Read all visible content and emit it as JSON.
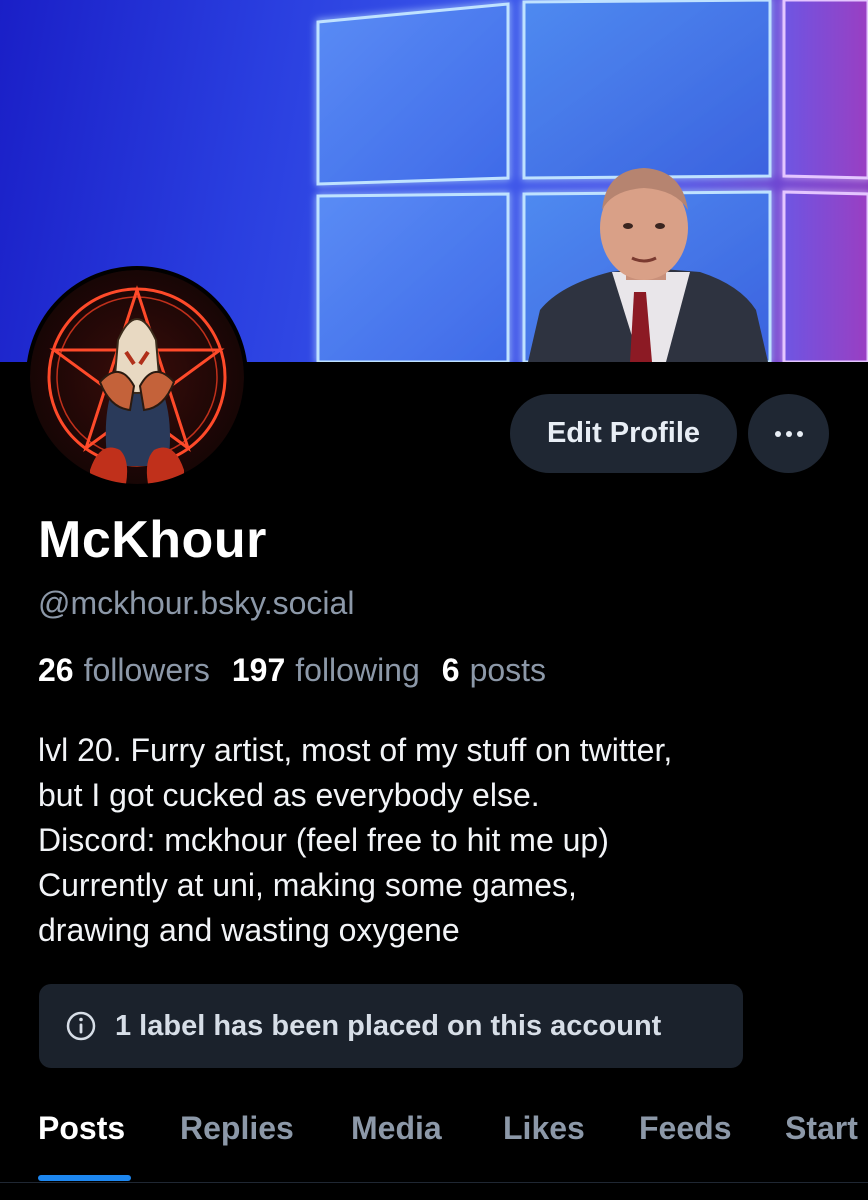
{
  "profile": {
    "display_name": "McKhour",
    "handle": "@mckhour.bsky.social",
    "stats": {
      "followers_count": "26",
      "followers_label": "followers",
      "following_count": "197",
      "following_label": "following",
      "posts_count": "6",
      "posts_label": "posts"
    },
    "bio_lines": [
      "lvl 20. Furry artist, most of my stuff on twitter,",
      "but I got cucked as everybody else.",
      "Discord: mckhour (feel free to hit me up)",
      "Currently at uni, making some games,",
      "drawing and wasting oxygene"
    ],
    "label_notice": "1 label has been placed on this account"
  },
  "actions": {
    "edit_profile": "Edit Profile",
    "more_icon": "more-horizontal-icon"
  },
  "tabs": [
    {
      "label": "Posts",
      "active": true
    },
    {
      "label": "Replies",
      "active": false
    },
    {
      "label": "Media",
      "active": false
    },
    {
      "label": "Likes",
      "active": false
    },
    {
      "label": "Feeds",
      "active": false
    },
    {
      "label": "Start",
      "active": false
    }
  ],
  "colors": {
    "background": "#000000",
    "button_bg": "#1f2733",
    "muted_text": "#8c98a8",
    "accent": "#1d87f0",
    "label_box_bg": "#1b222c"
  }
}
